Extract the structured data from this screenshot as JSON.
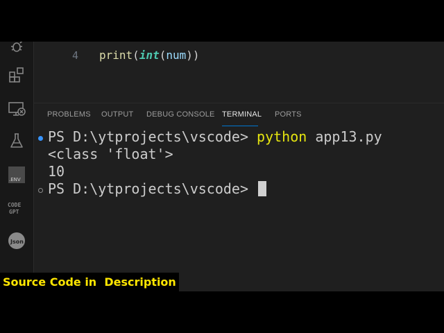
{
  "activity_bar": {
    "icons": [
      {
        "name": "debug-icon"
      },
      {
        "name": "extensions-icon"
      },
      {
        "name": "remote-explorer-icon"
      },
      {
        "name": "testing-icon"
      },
      {
        "name": "dotenv-icon",
        "label": ".ENV"
      },
      {
        "name": "codegpt-icon",
        "label": "CODE GPT"
      },
      {
        "name": "json-icon",
        "label": "Json"
      }
    ]
  },
  "editor": {
    "line_number": "4",
    "code": {
      "fn": "print",
      "open1": "(",
      "kw": "int",
      "open2": "(",
      "var": "num",
      "close": "))"
    }
  },
  "panel": {
    "tabs": [
      {
        "label": "PROBLEMS",
        "active": false
      },
      {
        "label": "OUTPUT",
        "active": false
      },
      {
        "label": "DEBUG CONSOLE",
        "active": false
      },
      {
        "label": "TERMINAL",
        "active": true
      },
      {
        "label": "PORTS",
        "active": false
      }
    ]
  },
  "terminal": {
    "prompt": "PS D:\\ytprojects\\vscode> ",
    "command": "python",
    "args": " app13.py",
    "output_1": "<class 'float'>",
    "output_2": "10"
  },
  "caption": "Source Code in  Description",
  "colors": {
    "accent": "#0078d4",
    "command": "#e5e510",
    "caption_text": "#ffe600",
    "success_dot": "#3794ff"
  }
}
